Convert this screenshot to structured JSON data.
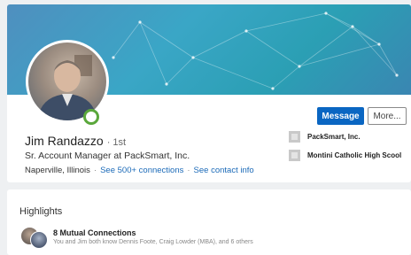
{
  "profile": {
    "name": "Jim Randazzo",
    "degree": "· 1st",
    "headline": "Sr. Account Manager at PackSmart, Inc.",
    "location": "Naperville, Illinois",
    "separator": "·",
    "connections_link": "See 500+ connections",
    "contact_link": "See contact info",
    "status": "online"
  },
  "actions": {
    "message_label": "Message",
    "more_label": "More..."
  },
  "organizations": [
    {
      "name": "PackSmart, Inc."
    },
    {
      "name": "Montini Catholic High Scool"
    }
  ],
  "highlights": {
    "title": "Highlights",
    "mutual_heading": "8 Mutual Connections",
    "mutual_detail": "You and Jim both know Dennis Foote, Craig Lowder (MBA), and 6 others"
  },
  "colors": {
    "accent": "#0a66c2",
    "link": "#1b6ab8",
    "online": "#5aa73b"
  }
}
